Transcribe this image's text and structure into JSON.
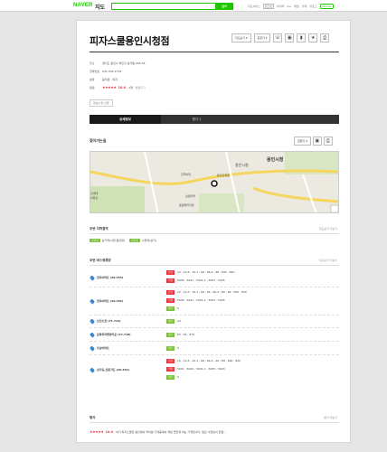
{
  "topbar": {
    "logo": "NAVER",
    "service": "지도",
    "search_placeholder": "",
    "search_button": "검색",
    "nav": [
      "지도서비스",
      "로그인",
      "네이버",
      "me",
      "메일",
      "카페",
      "블로그",
      "Mobile"
    ]
  },
  "place": {
    "name": "피자스쿨용인시청점",
    "buttons": {
      "map": "지도보기",
      "route": "길찾기"
    },
    "icons": [
      "phone-icon",
      "subway-icon",
      "bookmark-icon",
      "star-icon",
      "print-icon"
    ],
    "info": [
      {
        "k": "주소",
        "v": "경기도 용인시 처인구 삼가동 256-32"
      },
      {
        "k": "전화번호",
        "v": "031-333-1776"
      },
      {
        "k": "분류",
        "v": "음식점 › 피자"
      },
      {
        "k": "평점",
        "v": ""
      }
    ],
    "rating_stars": "★★★★★",
    "rating_score": "10.0",
    "rating_count": "1개",
    "rating_link": "별점주기",
    "edit_button": "정보수정 신청"
  },
  "tabs": [
    {
      "label": "상세정보",
      "active": true
    },
    {
      "label": "평가 1",
      "active": false
    }
  ],
  "directions": {
    "title": "찾아가는길",
    "route_button": "길찾기",
    "map_labels": [
      "용인시청",
      "용인교육청",
      "용인시청",
      "진무바위",
      "삼정마을",
      "동원플라자빌",
      "신세대",
      "아파트"
    ]
  },
  "subway": {
    "title": "주변 지하철역",
    "more": "지도보기 더보기",
    "items": [
      {
        "tag": "경전철",
        "name": "삼가역(시청.용인대)"
      },
      {
        "tag": "경전철",
        "name": "시청역(삼가)"
      }
    ]
  },
  "bus": {
    "title": "주변 버스정류장",
    "more": "지도보기 더보기",
    "stops": [
      {
        "name": "전우아파트 (29-353)",
        "routes": [
          {
            "tag": "간선",
            "color": "red",
            "text": "10 , 10-5 , 10-1 , 66 , 66-4 , 88 , 690 , 820"
          },
          {
            "tag": "직행",
            "color": "red",
            "text": "5000 , 5001 , 5001-1 , 5003 , 5005"
          }
        ]
      },
      {
        "name": "전우아파트 (29-352)",
        "routes": [
          {
            "tag": "간선",
            "color": "red",
            "text": "10 , 10-5 , 10-1 , 66 , 66 , 66-4 , 66 , 66 , 690 , 820"
          },
          {
            "tag": "직행",
            "color": "red",
            "text": "5000 , 5001 , 5001-1 , 5003 , 5005"
          },
          {
            "tag": "마을",
            "color": "green",
            "text": "5"
          }
        ]
      },
      {
        "name": "보건소앞 (47-714)",
        "routes": [
          {
            "tag": "마을",
            "color": "green",
            "text": "24"
          }
        ]
      },
      {
        "name": "문화복지행정타운 (47-718)",
        "routes": [
          {
            "tag": "마을",
            "color": "green",
            "text": "65 , 66 , 670"
          }
        ]
      },
      {
        "name": "우남아파트",
        "routes": [
          {
            "tag": "마을",
            "color": "green",
            "text": "5"
          }
        ]
      },
      {
        "name": "삼가동,신흥가든 (29-452)",
        "routes": [
          {
            "tag": "간선",
            "color": "red",
            "text": "10 , 10-5 , 10-1 , 66 , 66-4 , 66 , 88 , 690 , 820"
          },
          {
            "tag": "직행",
            "color": "red",
            "text": "5001 , 5000 , 5001-1 , 5005 , 5003"
          },
          {
            "tag": "마을",
            "color": "green",
            "text": "5"
          }
        ]
      }
    ]
  },
  "review": {
    "title": "평가",
    "more": "평가 더보기",
    "stars": "★★★★★",
    "score": "10.0",
    "text": "여기 피자스쿨은 용인에서 먹어본 가게중에서 제일 맛있게 하는 가게입니다. 일단 사장님이 친절..."
  },
  "colors": {
    "naver_green": "#1ec800",
    "red": "#e8383d",
    "blue": "#3b86d1"
  }
}
